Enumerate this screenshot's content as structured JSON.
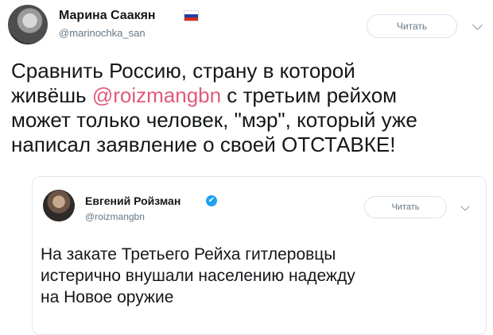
{
  "tweet": {
    "author_name": "Марина Саакян",
    "handle": "@marinochka_san",
    "follow_label": "Читать",
    "flag_colors": [
      "#ffffff",
      "#1c3fa8",
      "#d52b1e"
    ],
    "text_before": "Сравнить Россию, страну в которой\nживёшь ",
    "mention": "@roizmangbn",
    "text_after": " с третьим рейхом\nможет только человек, \"мэр\", который уже\nнаписал заявление о своей ОТСТАВКЕ!"
  },
  "quoted_tweet": {
    "author_name": "Евгений Ройзман",
    "verified_icon": "✔",
    "handle": "@roizmangbn",
    "follow_label": "Читать",
    "text": "На закате Третьего Рейха гитлеровцы\nистерично  внушали населению надежду\nна Новое оружие"
  },
  "colors": {
    "mention": "#e05a7a",
    "verified": "#1da1f2",
    "secondary_text": "#657786"
  }
}
